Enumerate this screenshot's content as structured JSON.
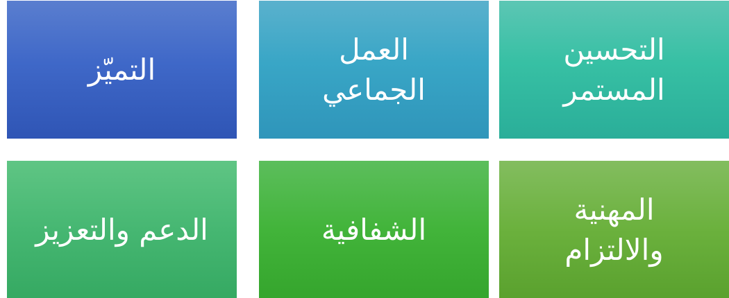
{
  "tiles": [
    {
      "line1": "التحسين",
      "line2": "المستمر"
    },
    {
      "line1": "العمل",
      "line2": "الجماعي"
    },
    {
      "line1": "التميّز"
    },
    {
      "line1": "المهنية",
      "line2": "والالتزام"
    },
    {
      "line1": "الشفافية"
    },
    {
      "line1": "الدعم والتعزيز"
    }
  ]
}
